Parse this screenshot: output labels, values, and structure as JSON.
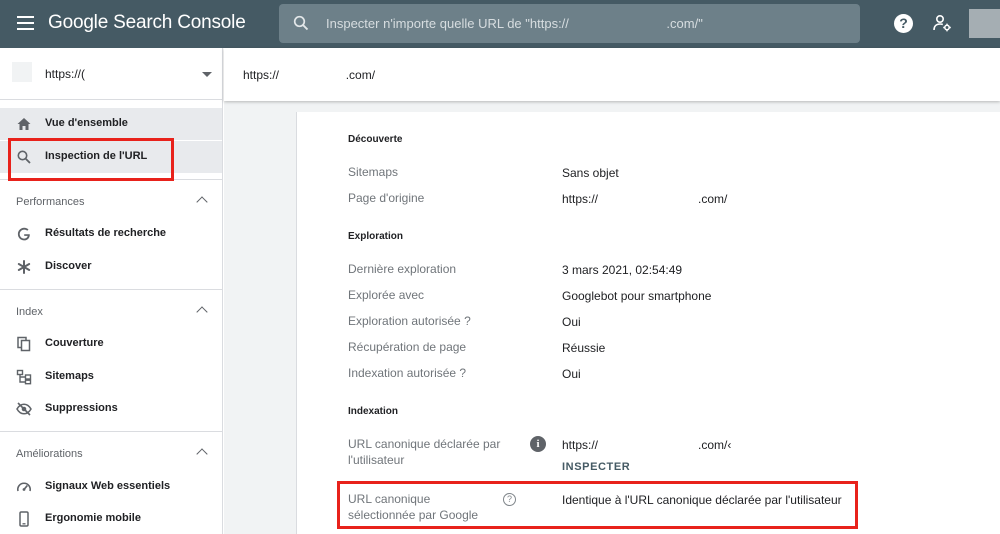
{
  "app": {
    "title_prefix": "Google",
    "title_suffix": "Search Console",
    "search_placeholder": "Inspecter n'importe quelle URL de \"https://                           .com/\"",
    "help_glyph": "?",
    "accent_color": "#455a64",
    "highlight_color": "#e8221b"
  },
  "sidebar": {
    "property": "https://(",
    "items": [
      {
        "label": "Vue d'ensemble",
        "icon": "home-icon"
      },
      {
        "label": "Inspection de l'URL",
        "icon": "search-icon"
      }
    ],
    "sections": [
      {
        "label": "Performances",
        "items": [
          {
            "label": "Résultats de recherche",
            "icon": "google-g-icon"
          },
          {
            "label": "Discover",
            "icon": "asterisk-icon"
          }
        ]
      },
      {
        "label": "Index",
        "items": [
          {
            "label": "Couverture",
            "icon": "pages-icon"
          },
          {
            "label": "Sitemaps",
            "icon": "sitemap-icon"
          },
          {
            "label": "Suppressions",
            "icon": "hidden-eye-icon"
          }
        ]
      },
      {
        "label": "Améliorations",
        "items": [
          {
            "label": "Signaux Web essentiels",
            "icon": "speedometer-icon"
          },
          {
            "label": "Ergonomie mobile",
            "icon": "smartphone-icon"
          }
        ]
      }
    ]
  },
  "main": {
    "inspected_url": "https://                    .com/",
    "decouverte": {
      "title": "Découverte",
      "rows": [
        {
          "label": "Sitemaps",
          "value": "Sans objet"
        },
        {
          "label": "Page d'origine",
          "value": "https://                              .com/"
        }
      ]
    },
    "exploration": {
      "title": "Exploration",
      "rows": [
        {
          "label": "Dernière exploration",
          "value": "3 mars 2021, 02:54:49"
        },
        {
          "label": "Explorée avec",
          "value": "Googlebot pour smartphone"
        },
        {
          "label": "Exploration autorisée ?",
          "value": "Oui"
        },
        {
          "label": "Récupération de page",
          "value": "Réussie"
        },
        {
          "label": "Indexation autorisée ?",
          "value": "Oui"
        }
      ]
    },
    "indexation": {
      "title": "Indexation",
      "declared_label_line1": "URL canonique déclarée par",
      "declared_label_line2": "l'utilisateur",
      "declared_value": "https://                              .com/‹",
      "info_glyph": "i",
      "inspect_label": "INSPECTER",
      "selected_label_line1": "URL canonique",
      "selected_label_line2": "sélectionnée par Google",
      "selected_help_glyph": "?",
      "selected_value": "Identique à l'URL canonique déclarée par l'utilisateur"
    }
  }
}
